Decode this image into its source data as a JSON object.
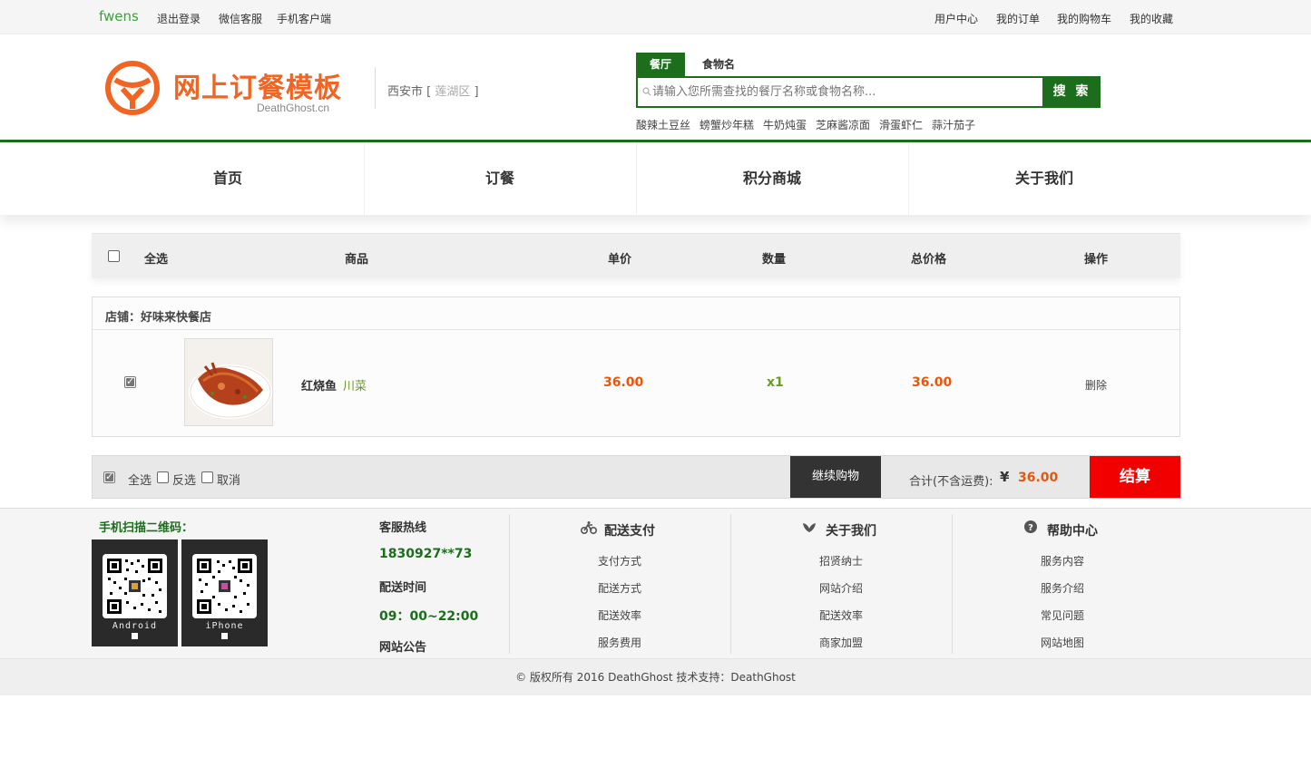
{
  "topbar": {
    "username": "fwens",
    "left_links": [
      "退出登录",
      "微信客服",
      "手机客户端"
    ],
    "right_links": [
      "用户中心",
      "我的订单",
      "我的购物车",
      "我的收藏"
    ]
  },
  "header": {
    "logo_title": "网上订餐模板",
    "logo_sub": "DeathGhost.cn",
    "city": "西安市",
    "district": "莲湖区",
    "search_tabs": [
      "餐厅",
      "食物名"
    ],
    "search_placeholder": "请输入您所需查找的餐厅名称或食物名称...",
    "search_button": "搜 索",
    "hot_keywords": [
      "酸辣土豆丝",
      "螃蟹炒年糕",
      "牛奶炖蛋",
      "芝麻酱凉面",
      "滑蛋虾仁",
      "蒜汁茄子"
    ]
  },
  "nav": [
    "首页",
    "订餐",
    "积分商城",
    "关于我们"
  ],
  "cart": {
    "headers": [
      "全选",
      "商品",
      "单价",
      "数量",
      "总价格",
      "操作"
    ],
    "shop_label": "店铺：好味来快餐店",
    "item": {
      "name": "红烧鱼",
      "category": "川菜",
      "unit_price": "36.00",
      "quantity": "x1",
      "total": "36.00",
      "action": "删除"
    },
    "bottom": {
      "select_all": "全选",
      "invert": "反选",
      "cancel": "取消",
      "continue": "继续购物",
      "total_label": "合计(不含运费):",
      "yen": "¥",
      "total_value": "36.00",
      "checkout": "结算"
    }
  },
  "footer": {
    "qr_title": "手机扫描二维码：",
    "qr_labels": [
      "Android",
      "iPhone"
    ],
    "hotline_label": "客服热线",
    "hotline": "1830927**73",
    "hours_label": "配送时间",
    "hours": "09：00~22:00",
    "notice_label": "网站公告",
    "columns": [
      {
        "title": "配送支付",
        "icon": "bicycle-icon",
        "items": [
          "支付方式",
          "配送方式",
          "配送效率",
          "服务费用"
        ]
      },
      {
        "title": "关于我们",
        "icon": "leaf-icon",
        "items": [
          "招贤纳士",
          "网站介绍",
          "配送效率",
          "商家加盟"
        ]
      },
      {
        "title": "帮助中心",
        "icon": "question-icon",
        "items": [
          "服务内容",
          "服务介绍",
          "常见问题",
          "网站地图"
        ]
      }
    ],
    "copyright": "© 版权所有 2016 DeathGhost 技术支持：DeathGhost"
  },
  "colors": {
    "brand_green": "#1c6e1c",
    "logo_orange": "#f06524",
    "price_orange": "#e6570e",
    "checkout_red": "#f20000"
  }
}
